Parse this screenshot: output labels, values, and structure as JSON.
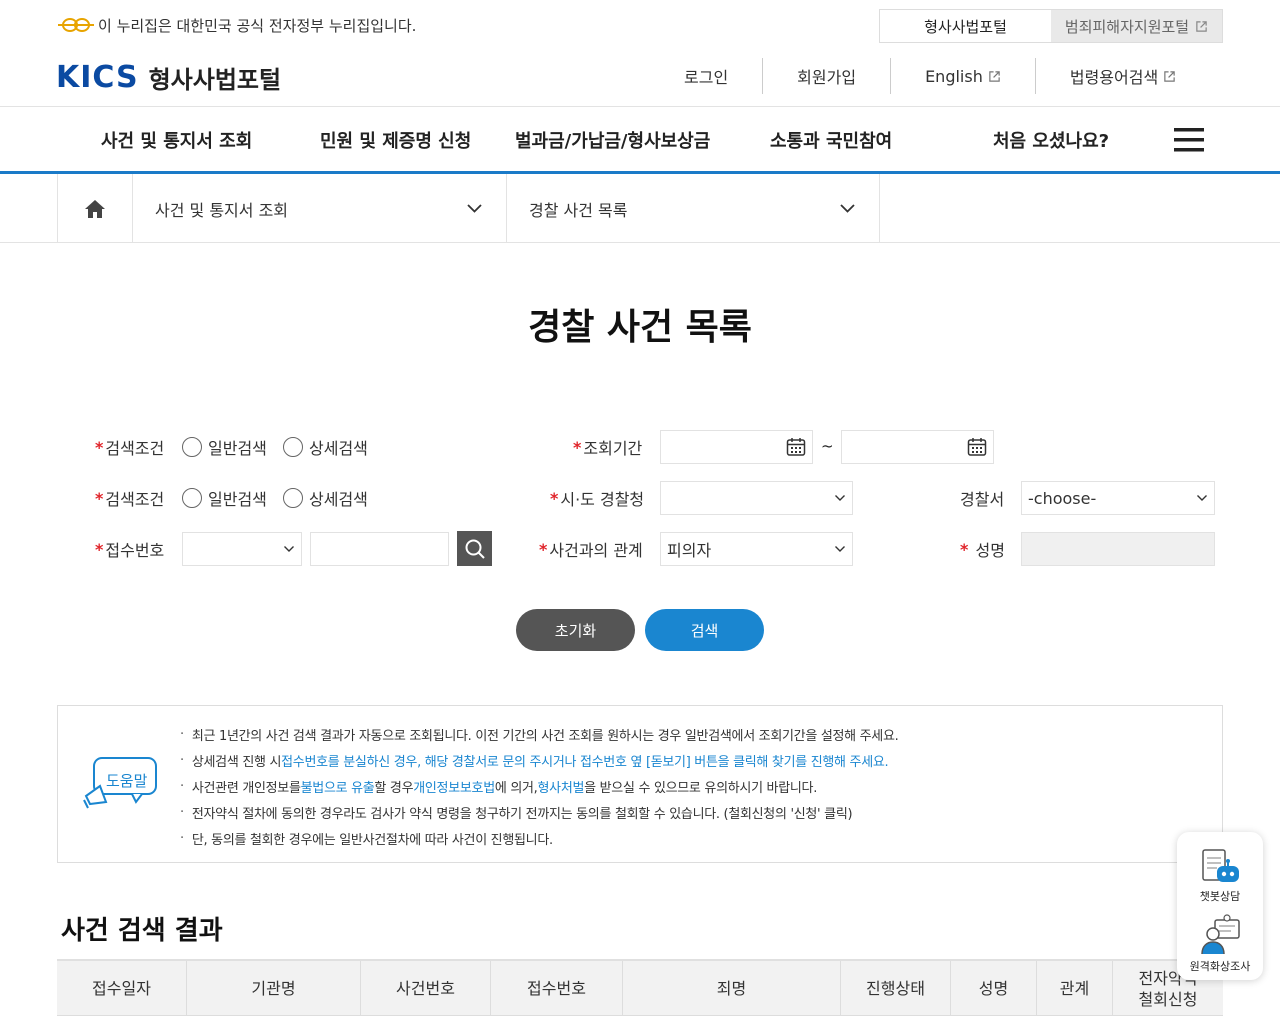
{
  "gov_notice": "이 누리집은 대한민국 공식 전자정부 누리집입니다.",
  "portal_tabs": [
    {
      "label": "형사사법포털",
      "active": true
    },
    {
      "label": "범죄피해자지원포털",
      "active": false
    }
  ],
  "brand": {
    "logo": "KICS",
    "name": "형사사법포털",
    "logo_color": "#0b4aa2"
  },
  "util_nav": [
    "로그인",
    "회원가입",
    "English",
    "법령용어검색"
  ],
  "gnb": [
    "사건 및 통지서 조회",
    "민원 및 제증명 신청",
    "벌과금/가납금/형사보상금",
    "소통과 국민참여",
    "처음 오셨나요?"
  ],
  "breadcrumb": {
    "level1": "사건 및 통지서 조회",
    "level2": "경찰 사건 목록"
  },
  "page_title": "경찰 사건 목록",
  "form": {
    "search_condition_label": "검색조건",
    "radio_general": "일반검색",
    "radio_detail": "상세검색",
    "period_label": "조회기간",
    "period_sep": "~",
    "police_label": "시·도 경찰청",
    "station_label": "경찰서",
    "station_value": "-choose-",
    "receipt_label": "접수번호",
    "relation_label": "사건과의 관계",
    "relation_value": "피의자",
    "name_label": "성명",
    "reset_button": "초기화",
    "search_button": "검색"
  },
  "notice": {
    "icon_label": "도움말",
    "lines": [
      {
        "parts": [
          {
            "t": "최근 1년간의 사건 검색 결과가 자동으로 조회됩니다. 이전 기간의 사건 조회를 원하시는 경우 일반검색에서 조회기간을 설정해 주세요.",
            "hl": false
          }
        ]
      },
      {
        "parts": [
          {
            "t": "상세검색 진행 시 ",
            "hl": false
          },
          {
            "t": "접수번호를 분실하신 경우, 해당 경찰서로 문의 주시거나 접수번호 옆 [돋보기] 버튼을 클릭해 찾기를 진행해 주세요.",
            "hl": true
          }
        ]
      },
      {
        "parts": [
          {
            "t": "사건관련 개인정보를 ",
            "hl": false
          },
          {
            "t": "불법으로 유출",
            "hl": true
          },
          {
            "t": "할 경우 ",
            "hl": false
          },
          {
            "t": "개인정보보호법",
            "hl": true
          },
          {
            "t": "에 의거, ",
            "hl": false
          },
          {
            "t": "형사처벌",
            "hl": true
          },
          {
            "t": "을 받으실 수 있으므로 유의하시기 바랍니다.",
            "hl": false
          }
        ]
      },
      {
        "parts": [
          {
            "t": "전자약식 절차에 동의한 경우라도 검사가 약식 명령을 청구하기 전까지는 동의를 철회할 수 있습니다. (철회신청의 '신청' 클릭)",
            "hl": false
          }
        ]
      },
      {
        "parts": [
          {
            "t": "단, 동의를 철회한 경우에는 일반사건절차에 따라 사건이 진행됩니다.",
            "hl": false
          }
        ]
      }
    ]
  },
  "results_title": "사건 검색 결과",
  "table_headers": [
    "접수일자",
    "기관명",
    "사건번호",
    "접수번호",
    "죄명",
    "진행상태",
    "성명",
    "관계",
    "전자약식\n철회신청"
  ],
  "floating": {
    "chatbot": "챗봇상담",
    "video": "원격화상조사"
  },
  "colors": {
    "accent": "#1a86d0",
    "required": "#e0242a",
    "gnb_line": "#1a7ac8"
  }
}
